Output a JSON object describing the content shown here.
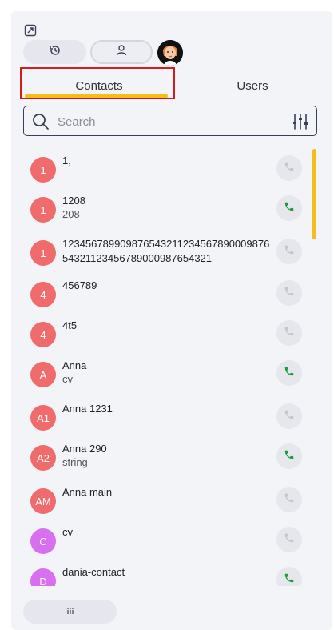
{
  "tabs": {
    "contacts": "Contacts",
    "users": "Users"
  },
  "search": {
    "placeholder": "Search"
  },
  "colors": {
    "accent": "#f3bd1c",
    "active_call": "#1f9a3c",
    "inactive_call": "#c3c5cc",
    "avatar_red": "#f06b6b",
    "avatar_purple": "#d86ef0"
  },
  "contacts": [
    {
      "initials": "1",
      "name": "1,",
      "sub": "",
      "call_active": false,
      "avatar_color": "#f06b6b"
    },
    {
      "initials": "1",
      "name": "1208",
      "sub": "208",
      "call_active": true,
      "avatar_color": "#f06b6b"
    },
    {
      "initials": "1",
      "name": "12345678990987654321123456789000987654321123456789000987654321",
      "sub": "",
      "call_active": false,
      "avatar_color": "#f06b6b"
    },
    {
      "initials": "4",
      "name": "456789",
      "sub": "",
      "call_active": false,
      "avatar_color": "#f06b6b"
    },
    {
      "initials": "4",
      "name": "4t5",
      "sub": "",
      "call_active": false,
      "avatar_color": "#f06b6b"
    },
    {
      "initials": "A",
      "name": "Anna",
      "sub": "cv",
      "call_active": true,
      "avatar_color": "#f06b6b"
    },
    {
      "initials": "A1",
      "name": "Anna 1231",
      "sub": "",
      "call_active": false,
      "avatar_color": "#f06b6b"
    },
    {
      "initials": "A2",
      "name": "Anna 290",
      "sub": "string",
      "call_active": true,
      "avatar_color": "#f06b6b"
    },
    {
      "initials": "AM",
      "name": "Anna main",
      "sub": "",
      "call_active": false,
      "avatar_color": "#f06b6b"
    },
    {
      "initials": "C",
      "name": "cv",
      "sub": "",
      "call_active": false,
      "avatar_color": "#d86ef0"
    },
    {
      "initials": "D",
      "name": "dania-contact",
      "sub": "",
      "call_active": true,
      "avatar_color": "#d86ef0"
    }
  ],
  "scroll": {
    "position": 0
  }
}
